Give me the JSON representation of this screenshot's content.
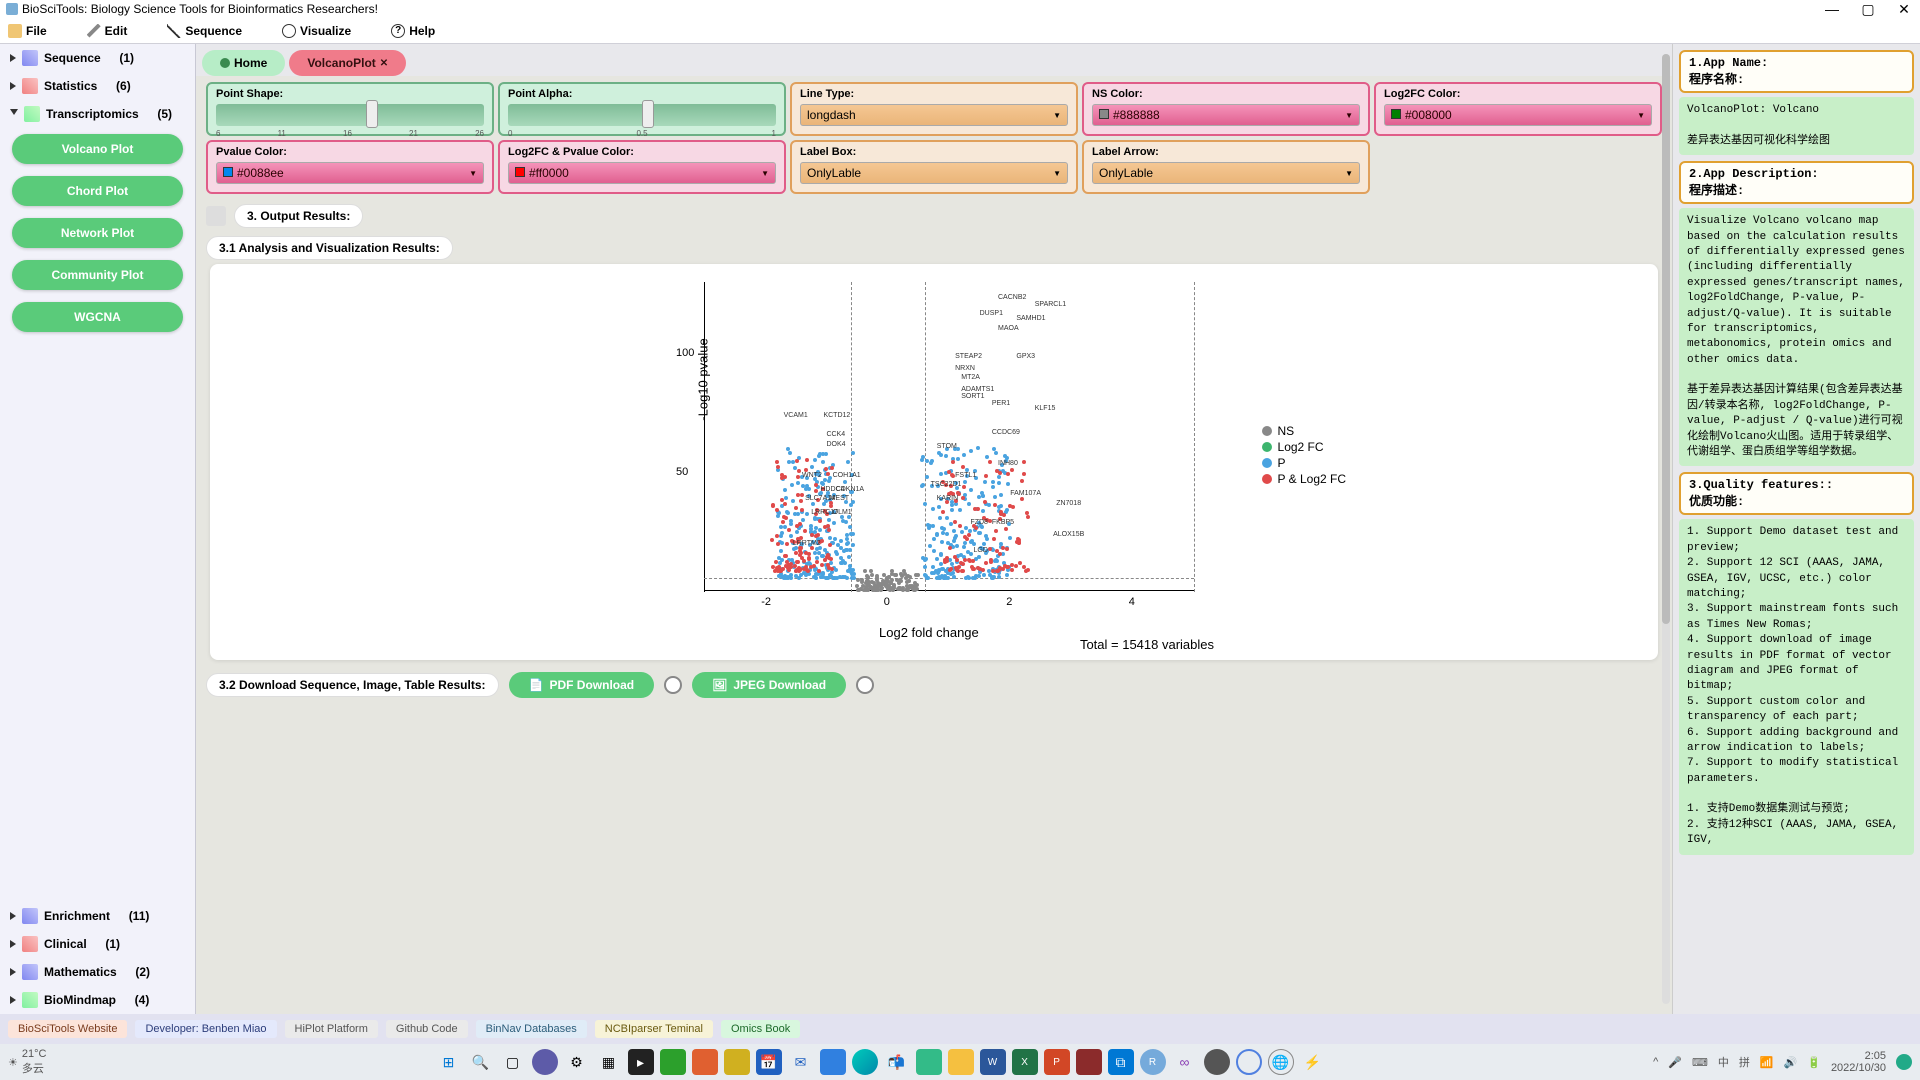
{
  "window": {
    "title": "BioSciTools: Biology Science Tools for Bioinformatics Researchers!"
  },
  "menubar": [
    "File",
    "Edit",
    "Sequence",
    "Visualize",
    "Help"
  ],
  "sidebar": {
    "groups": [
      {
        "label": "Sequence",
        "count": "(1)",
        "open": false
      },
      {
        "label": "Statistics",
        "count": "(6)",
        "open": false
      },
      {
        "label": "Transcriptomics",
        "count": "(5)",
        "open": true,
        "items": [
          "Volcano Plot",
          "Chord Plot",
          "Network Plot",
          "Community Plot",
          "WGCNA"
        ]
      },
      {
        "label": "Enrichment",
        "count": "(11)",
        "open": false
      },
      {
        "label": "Clinical",
        "count": "(1)",
        "open": false
      },
      {
        "label": "Mathematics",
        "count": "(2)",
        "open": false
      },
      {
        "label": "BioMindmap",
        "count": "(4)",
        "open": false
      }
    ]
  },
  "tabs": {
    "home": "Home",
    "active": "VolcanoPlot"
  },
  "options": {
    "point_shape": {
      "label": "Point Shape:",
      "ticks": [
        "6",
        "11",
        "16",
        "21",
        "26"
      ],
      "knob_pct": 56
    },
    "point_alpha": {
      "label": "Point Alpha:",
      "ticks": [
        "0",
        "0.5",
        "1"
      ],
      "knob_pct": 50
    },
    "line_type": {
      "label": "Line Type:",
      "value": "longdash"
    },
    "ns_color": {
      "label": "NS Color:",
      "value": "#888888",
      "swatch": "#888888"
    },
    "log2fc_color": {
      "label": "Log2FC Color:",
      "value": "#008000",
      "swatch": "#008000"
    },
    "pvalue_color": {
      "label": "Pvalue Color:",
      "value": "#0088ee",
      "swatch": "#0088ee"
    },
    "log2fc_pvalue_color": {
      "label": "Log2FC & Pvalue Color:",
      "value": "#ff0000",
      "swatch": "#ff0000"
    },
    "label_box": {
      "label": "Label Box:",
      "value": "OnlyLable"
    },
    "label_arrow": {
      "label": "Label Arrow:",
      "value": "OnlyLable"
    }
  },
  "sections": {
    "output": "3. Output Results:",
    "analysis": "3.1 Analysis and Visualization Results:",
    "download": "3.2 Download Sequence, Image, Table Results:"
  },
  "download": {
    "pdf": "PDF Download",
    "jpeg": "JPEG Download"
  },
  "chart_data": {
    "type": "scatter",
    "title": "",
    "xlabel": "Log2 fold change",
    "ylabel": "-Log10 pvalue",
    "xlim": [
      -3,
      5
    ],
    "ylim": [
      0,
      130
    ],
    "x_ticks": [
      -2,
      0,
      2,
      4
    ],
    "y_ticks": [
      50,
      100
    ],
    "vlines": [
      -0.6,
      0.6
    ],
    "hlines": [
      5
    ],
    "total_text": "Total = 15418 variables",
    "legend": [
      {
        "name": "NS",
        "color": "#888888"
      },
      {
        "name": "Log2 FC",
        "color": "#3db56e"
      },
      {
        "name": "P",
        "color": "#4aa3e0"
      },
      {
        "name": "P & Log2 FC",
        "color": "#e04a4a"
      }
    ],
    "gene_labels": [
      {
        "name": "CACNB2",
        "x": 1.8,
        "y": 125
      },
      {
        "name": "SPARCL1",
        "x": 2.4,
        "y": 122
      },
      {
        "name": "DUSP1",
        "x": 1.5,
        "y": 118
      },
      {
        "name": "SAMHD1",
        "x": 2.1,
        "y": 116
      },
      {
        "name": "MAOA",
        "x": 1.8,
        "y": 112
      },
      {
        "name": "STEAP2",
        "x": 1.1,
        "y": 100
      },
      {
        "name": "GPX3",
        "x": 2.1,
        "y": 100
      },
      {
        "name": "NRXN",
        "x": 1.1,
        "y": 95
      },
      {
        "name": "MT2A",
        "x": 1.2,
        "y": 91
      },
      {
        "name": "ADAMTS1",
        "x": 1.2,
        "y": 86
      },
      {
        "name": "SORT1",
        "x": 1.2,
        "y": 83
      },
      {
        "name": "PER1",
        "x": 1.7,
        "y": 80
      },
      {
        "name": "KLF15",
        "x": 2.4,
        "y": 78
      },
      {
        "name": "VCAM1",
        "x": -1.7,
        "y": 75
      },
      {
        "name": "KCTD12",
        "x": -1.05,
        "y": 75
      },
      {
        "name": "CCDC69",
        "x": 1.7,
        "y": 68
      },
      {
        "name": "CCK4",
        "x": -1.0,
        "y": 67
      },
      {
        "name": "DOK4",
        "x": -1.0,
        "y": 63
      },
      {
        "name": "STOM",
        "x": 0.8,
        "y": 62
      },
      {
        "name": "INH80",
        "x": 1.8,
        "y": 55
      },
      {
        "name": "WNT2",
        "x": -1.4,
        "y": 50
      },
      {
        "name": "COH1A1",
        "x": -0.9,
        "y": 50
      },
      {
        "name": "FSTL1",
        "x": 1.1,
        "y": 50
      },
      {
        "name": "TSC22D1",
        "x": 0.7,
        "y": 46
      },
      {
        "name": "HDDC4",
        "x": -1.1,
        "y": 44
      },
      {
        "name": "CDKN1A",
        "x": -0.85,
        "y": 44
      },
      {
        "name": "FAM107A",
        "x": 2.0,
        "y": 42
      },
      {
        "name": "SLC7A14",
        "x": -1.35,
        "y": 40
      },
      {
        "name": "MEST",
        "x": -0.95,
        "y": 40
      },
      {
        "name": "KARIN",
        "x": 0.8,
        "y": 40
      },
      {
        "name": "ZN7018",
        "x": 2.75,
        "y": 38
      },
      {
        "name": "LRRC17",
        "x": -1.25,
        "y": 34
      },
      {
        "name": "OLM1",
        "x": -0.9,
        "y": 34
      },
      {
        "name": "FZD8",
        "x": 1.35,
        "y": 30
      },
      {
        "name": "FKBP5",
        "x": 1.7,
        "y": 30
      },
      {
        "name": "ALOX15B",
        "x": 2.7,
        "y": 25
      },
      {
        "name": "LRRTM2",
        "x": -1.55,
        "y": 21
      },
      {
        "name": "LGD",
        "x": 1.4,
        "y": 18
      }
    ],
    "point_clusters": [
      {
        "color": "#888888",
        "xr": [
          -0.5,
          0.5
        ],
        "yr": [
          0,
          8
        ],
        "n": 120
      },
      {
        "color": "#4aa3e0",
        "xr": [
          -1.8,
          -0.55
        ],
        "yr": [
          5,
          60
        ],
        "n": 240
      },
      {
        "color": "#4aa3e0",
        "xr": [
          0.55,
          2.0
        ],
        "yr": [
          5,
          60
        ],
        "n": 220
      },
      {
        "color": "#e04a4a",
        "xr": [
          -1.9,
          -0.9
        ],
        "yr": [
          8,
          55
        ],
        "n": 120
      },
      {
        "color": "#e04a4a",
        "xr": [
          0.9,
          2.3
        ],
        "yr": [
          8,
          55
        ],
        "n": 110
      }
    ]
  },
  "rightpane": {
    "s1_head": "1.App Name:\n程序名称:",
    "s1_body": "VolcanoPlot: Volcano\n\n差异表达基因可视化科学绘图",
    "s2_head": "2.App Description:\n程序描述:",
    "s2_body": "Visualize Volcano volcano map based on the calculation results of differentially expressed genes (including differentially expressed genes/transcript names, log2FoldChange, P-value, P-adjust/Q-value). It is suitable for transcriptomics, metabonomics, protein omics and other omics data.\n\n基于差异表达基因计算结果(包含差异表达基因/转录本名称, log2FoldChange, P-value, P-adjust / Q-value)进行可视化绘制Volcano火山图。适用于转录组学、代谢组学、蛋白质组学等组学数据。",
    "s3_head": "3.Quality features::\n优质功能:",
    "s3_body": "1. Support Demo dataset test and preview;\n2. Support 12 SCI (AAAS, JAMA, GSEA, IGV, UCSC, etc.) color matching;\n3. Support mainstream fonts such as Times New Romas;\n4. Support download of image results in PDF format of vector diagram and JPEG format of bitmap;\n5. Support custom color and transparency of each part;\n6. Support adding background and arrow indication to labels;\n7. Support to modify statistical parameters.\n\n1. 支持Demo数据集测试与预览;\n2. 支持12种SCI (AAAS, JAMA, GSEA, IGV,"
  },
  "footer": [
    "BioSciTools Website",
    "Developer: Benben Miao",
    "HiPlot Platform",
    "Github Code",
    "BinNav Databases",
    "NCBIparser Teminal",
    "Omics Book"
  ],
  "taskbar": {
    "weather_temp": "21°C",
    "weather_desc": "多云",
    "time": "2:05",
    "date": "2022/10/30",
    "ime": "中",
    "pin": "拼"
  }
}
